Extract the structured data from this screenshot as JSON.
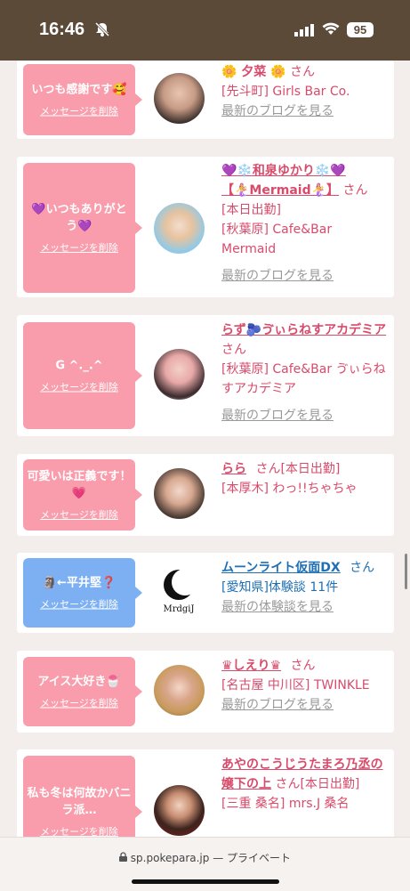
{
  "status_bar": {
    "time": "16:46",
    "battery": "95"
  },
  "cards": [
    {
      "message": "いつも感謝です🥰",
      "delete": "メッセージを削除",
      "name": "🌼 夕菜 🌼",
      "san": "さん",
      "loc": "[先斗町] Girls Bar Co.",
      "blog": "最新のブログを見る"
    },
    {
      "message": "💜いつもありがとう💜",
      "delete": "メッセージを削除",
      "name": "💜❄️和泉ゆかり❄️💜【🧜‍♀️Mermaid🧜‍♀️】",
      "san": "さん",
      "loc": "[本日出勤]",
      "loc2": "[秋葉原] Cafe&Bar Mermaid",
      "blog": "最新のブログを見る"
    },
    {
      "message": "G ^._.^",
      "delete": "メッセージを削除",
      "name": "らず🫐ゔぃらねすアカデミア",
      "san": "さん",
      "loc": "[秋葉原] Cafe&Bar ゔぃらねすアカデミア",
      "blog": "最新のブログを見る"
    },
    {
      "message": "可愛いは正義です！💗",
      "delete": "メッセージを削除",
      "name": "らら",
      "san": "さん[本日出勤]",
      "loc": "[本厚木] わっ!!ちゃちゃ",
      "blog": ""
    },
    {
      "message": "🗿←平井堅❓",
      "delete": "メッセージを削除",
      "name": "ムーンライト仮面DX",
      "san": "さん",
      "loc": "[愛知県]体験談 11件",
      "blog": "最新の体験談を見る"
    },
    {
      "message": "アイス大好き🍧",
      "delete": "メッセージを削除",
      "name": "♛しえり♛",
      "san": "さん",
      "loc": "[名古屋 中川区] TWINKLE",
      "blog": "最新のブログを見る"
    },
    {
      "message": "私も冬は何故かバニラ派…",
      "delete": "メッセージを削除",
      "name": "あやのこうじうたまろ乃丞の嬢下の上",
      "san": "さん[本日出勤]",
      "loc": "[三重 桑名] mrs.J 桑名",
      "blog": ""
    }
  ],
  "shop_logo_text": "MrdgiJ",
  "bottom_bar": {
    "url": "sp.pokepara.jp",
    "mode": "— プライベート"
  }
}
